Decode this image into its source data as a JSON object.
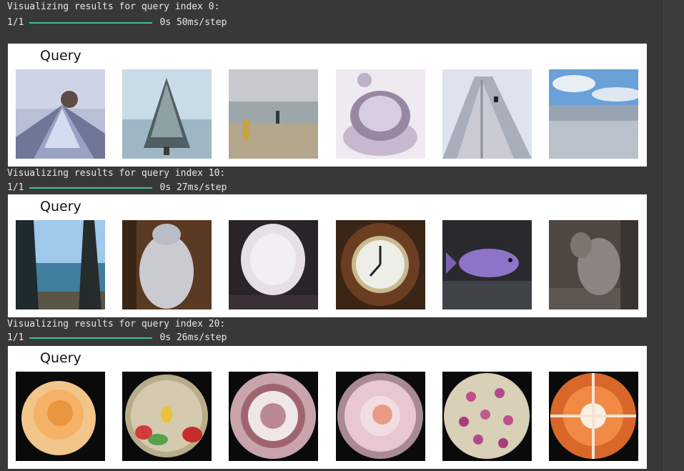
{
  "results": [
    {
      "header": "Visualizing results for query index 0:",
      "progress_count": "1/1",
      "progress_time": "0s 50ms/step",
      "panel_title": "Query",
      "images": [
        "mountain-peak-image",
        "snowy-tree-image",
        "beach-people-image",
        "glass-jewelry-image",
        "skyscraper-image",
        "ocean-shore-image"
      ]
    },
    {
      "header": "Visualizing results for query index 10:",
      "progress_count": "1/1",
      "progress_time": "0s 27ms/step",
      "panel_title": "Query",
      "images": [
        "lake-trees-image",
        "white-sack-image",
        "white-plate-image",
        "wall-clock-image",
        "purple-fish-image",
        "raccoon-image"
      ]
    },
    {
      "header": "Visualizing results for query index 20:",
      "progress_count": "1/1",
      "progress_time": "0s 26ms/step",
      "panel_title": "Query",
      "images": [
        "orange-rose-image",
        "fishbowl-image",
        "patterned-plate-image",
        "pink-plate-image",
        "floral-plate-image",
        "orange-plate-image"
      ]
    }
  ],
  "colors": {
    "background": "#383838",
    "progress": "#3fbf8f",
    "panel": "#ffffff"
  }
}
